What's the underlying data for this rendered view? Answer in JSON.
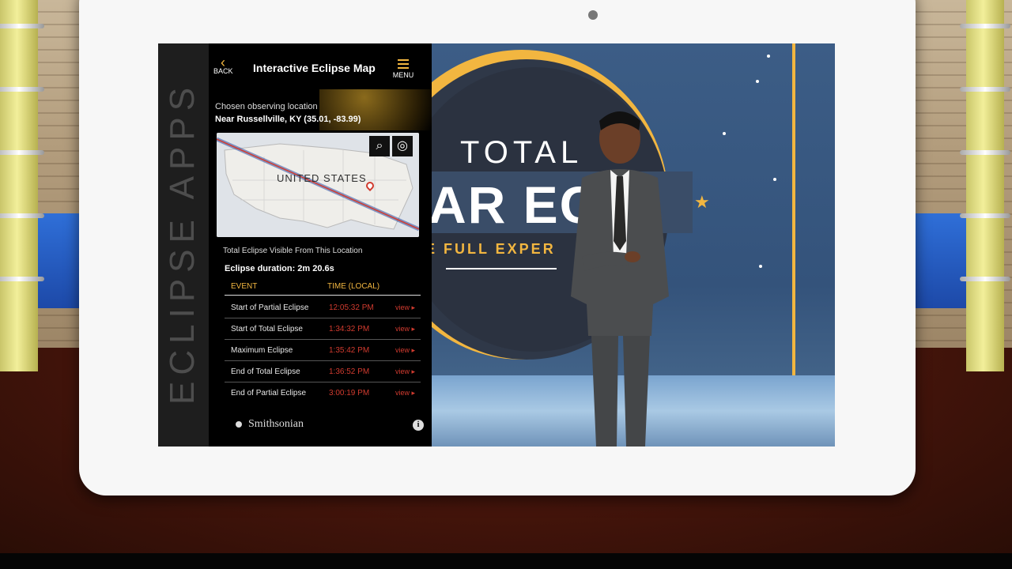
{
  "sidebar_brand": "ECLIPSE APPS",
  "app": {
    "title": "Interactive Eclipse Map",
    "back_label": "BACK",
    "menu_label": "MENU",
    "location_label": "Chosen observing location",
    "location_value": "Near Russellville, KY (35.01, -83.99)",
    "map_country_label": "UNITED STATES",
    "visibility_text": "Total Eclipse Visible From This Location",
    "duration_text": "Eclipse duration: 2m 20.6s",
    "table": {
      "col_event": "EVENT",
      "col_time": "TIME (LOCAL)",
      "rows": [
        {
          "event": "Start of Partial Eclipse",
          "time": "12:05:32 PM",
          "link": "view ▸"
        },
        {
          "event": "Start of Total Eclipse",
          "time": "1:34:32 PM",
          "link": "view ▸"
        },
        {
          "event": "Maximum Eclipse",
          "time": "1:35:42 PM",
          "link": "view ▸"
        },
        {
          "event": "End of Total Eclipse",
          "time": "1:36:52 PM",
          "link": "view ▸"
        },
        {
          "event": "End of Partial Eclipse",
          "time": "3:00:19 PM",
          "link": "view ▸"
        }
      ]
    },
    "footer_brand": "Smithsonian",
    "info_glyph": "i"
  },
  "graphic": {
    "line1": "TOTAL",
    "line2": "AR ECL",
    "line3": "E FULL EXPER"
  },
  "icons": {
    "back": "chevron-left-icon",
    "menu": "hamburger-icon",
    "search": "search-icon",
    "locate": "crosshair-icon",
    "pin": "map-pin-icon",
    "info": "info-icon"
  },
  "colors": {
    "accent": "#f2b640",
    "time_red": "#d13b2f",
    "eclipse_path": "#d13b2f",
    "graphic_bg": "#3c5d86"
  }
}
